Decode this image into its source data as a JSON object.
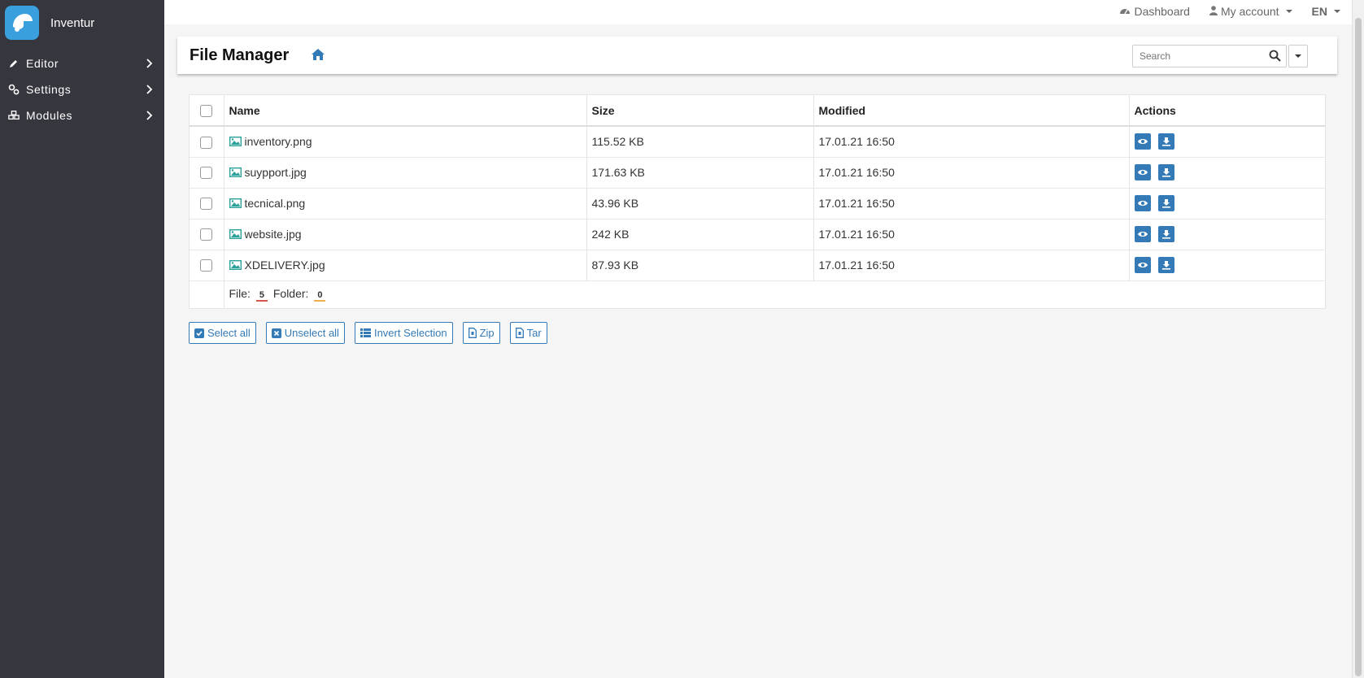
{
  "app": {
    "name": "Inventur"
  },
  "sidebar": {
    "items": [
      {
        "label": "Editor",
        "icon": "pencil-icon"
      },
      {
        "label": "Settings",
        "icon": "settings-icon"
      },
      {
        "label": "Modules",
        "icon": "cubes-icon"
      }
    ]
  },
  "topbar": {
    "dashboard": "Dashboard",
    "account": "My account",
    "language": "EN"
  },
  "header": {
    "title": "File Manager",
    "search_placeholder": "Search"
  },
  "table": {
    "columns": [
      "Name",
      "Size",
      "Modified",
      "Actions"
    ],
    "rows": [
      {
        "name": "inventory.png",
        "size": "115.52 KB",
        "modified": "17.01.21 16:50"
      },
      {
        "name": "suypport.jpg",
        "size": "171.63 KB",
        "modified": "17.01.21 16:50"
      },
      {
        "name": "tecnical.png",
        "size": "43.96 KB",
        "modified": "17.01.21 16:50"
      },
      {
        "name": "website.jpg",
        "size": "242 KB",
        "modified": "17.01.21 16:50"
      },
      {
        "name": "XDELIVERY.jpg",
        "size": "87.93 KB",
        "modified": "17.01.21 16:50"
      }
    ],
    "footer": {
      "file_label": "File:",
      "file_count": "5",
      "folder_label": "Folder:",
      "folder_count": "0"
    }
  },
  "buttons": {
    "select_all": "Select all",
    "unselect_all": "Unselect all",
    "invert": "Invert Selection",
    "zip": "Zip",
    "tar": "Tar"
  },
  "colors": {
    "sidebar_bg": "#36363f",
    "accent": "#337ab7",
    "file_icon": "#2aa198"
  }
}
